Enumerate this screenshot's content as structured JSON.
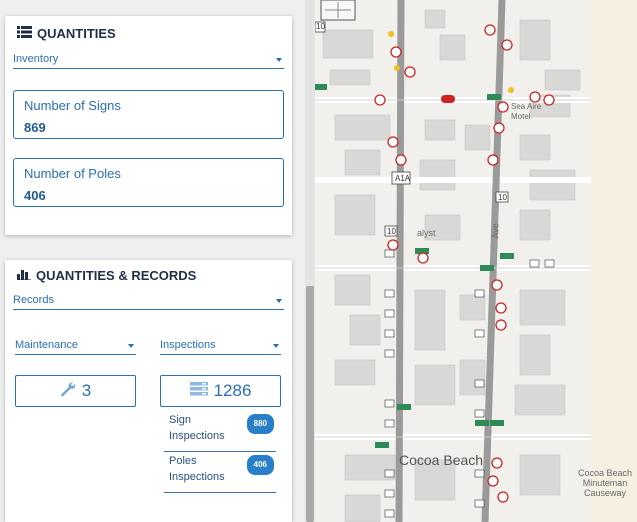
{
  "quantities": {
    "title": "QUANTITIES",
    "dropdown": "Inventory",
    "signs_label": "Number of Signs",
    "signs_value": "869",
    "poles_label": "Number of Poles",
    "poles_value": "406"
  },
  "records": {
    "title": "QUANTITIES & RECORDS",
    "dropdown": "Records",
    "maintenance_dropdown": "Maintenance",
    "inspections_dropdown": "Inspections",
    "maintenance_count": "3",
    "inspections_count": "1286",
    "inspection_rows": [
      {
        "line1": "Sign",
        "line2": "Inspections",
        "badge": "880"
      },
      {
        "line1": "Poles",
        "line2": "Inspections",
        "badge": "406"
      }
    ]
  },
  "map": {
    "labels": {
      "city": "Cocoa Beach",
      "causeway_1": "Cocoa Beach",
      "causeway_2": "Minuteman",
      "causeway_3": "Causeway",
      "motel_1": "Sea Aire",
      "motel_2": "Motel",
      "road_a1a": "A1A",
      "road_10a": "10",
      "road_10b": "10",
      "road_10c": "10",
      "catalyst": "alyst",
      "ave": "Ave"
    },
    "colors": {
      "road": "#8a8a8a",
      "building": "#d8d8d6",
      "water": "#f6efe2",
      "accent_green": "#2e8b57",
      "sign_red": "#cc2222"
    }
  }
}
